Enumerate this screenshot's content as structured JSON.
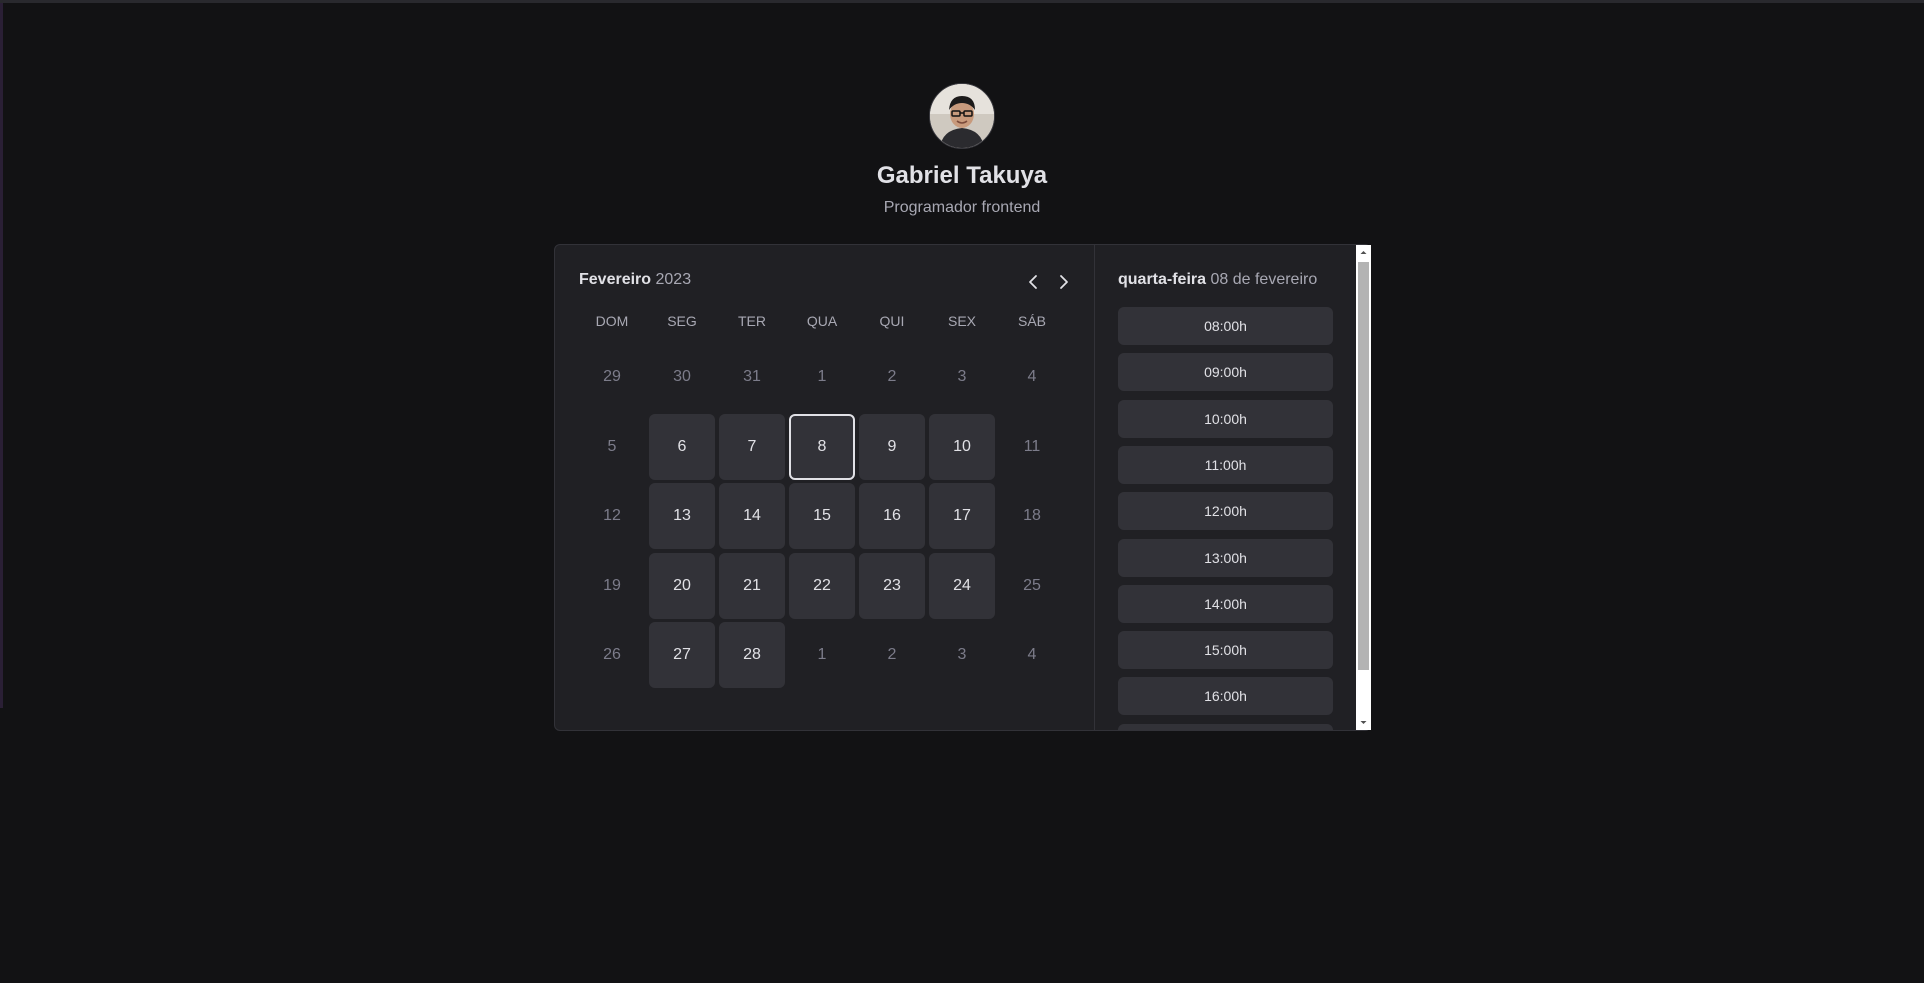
{
  "profile": {
    "name": "Gabriel Takuya",
    "role": "Programador frontend"
  },
  "calendar": {
    "month": "Fevereiro",
    "year": "2023",
    "weekdays": [
      "DOM",
      "SEG",
      "TER",
      "QUA",
      "QUI",
      "SEX",
      "SÁB"
    ],
    "selected_day": "8",
    "weeks": [
      [
        {
          "d": "29",
          "s": "muted"
        },
        {
          "d": "30",
          "s": "muted"
        },
        {
          "d": "31",
          "s": "muted"
        },
        {
          "d": "1",
          "s": "muted"
        },
        {
          "d": "2",
          "s": "muted"
        },
        {
          "d": "3",
          "s": "muted"
        },
        {
          "d": "4",
          "s": "muted"
        }
      ],
      [
        {
          "d": "5",
          "s": "muted"
        },
        {
          "d": "6",
          "s": "available"
        },
        {
          "d": "7",
          "s": "available"
        },
        {
          "d": "8",
          "s": "selected"
        },
        {
          "d": "9",
          "s": "available"
        },
        {
          "d": "10",
          "s": "available"
        },
        {
          "d": "11",
          "s": "muted"
        }
      ],
      [
        {
          "d": "12",
          "s": "muted"
        },
        {
          "d": "13",
          "s": "available"
        },
        {
          "d": "14",
          "s": "available"
        },
        {
          "d": "15",
          "s": "available"
        },
        {
          "d": "16",
          "s": "available"
        },
        {
          "d": "17",
          "s": "available"
        },
        {
          "d": "18",
          "s": "muted"
        }
      ],
      [
        {
          "d": "19",
          "s": "muted"
        },
        {
          "d": "20",
          "s": "available"
        },
        {
          "d": "21",
          "s": "available"
        },
        {
          "d": "22",
          "s": "available"
        },
        {
          "d": "23",
          "s": "available"
        },
        {
          "d": "24",
          "s": "available"
        },
        {
          "d": "25",
          "s": "muted"
        }
      ],
      [
        {
          "d": "26",
          "s": "muted"
        },
        {
          "d": "27",
          "s": "available"
        },
        {
          "d": "28",
          "s": "available"
        },
        {
          "d": "1",
          "s": "muted"
        },
        {
          "d": "2",
          "s": "muted"
        },
        {
          "d": "3",
          "s": "muted"
        },
        {
          "d": "4",
          "s": "muted"
        }
      ]
    ],
    "icons": {
      "prev": "chevron-left-icon",
      "next": "chevron-right-icon"
    }
  },
  "time_picker": {
    "weekday": "quarta-feira",
    "date": "08 de fevereiro",
    "slots": [
      "08:00h",
      "09:00h",
      "10:00h",
      "11:00h",
      "12:00h",
      "13:00h",
      "14:00h",
      "15:00h",
      "16:00h",
      ""
    ]
  },
  "colors": {
    "background": "#121214",
    "card": "#202024",
    "day_available": "#323238",
    "text": "#e1e1e6",
    "text_muted": "#7c7c8a"
  }
}
